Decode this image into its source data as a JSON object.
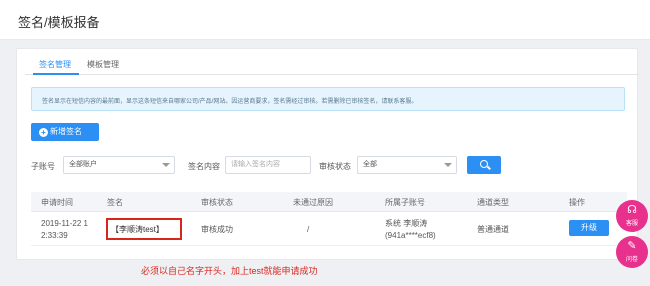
{
  "page": {
    "title": "签名/模板报备"
  },
  "tabs": [
    {
      "label": "签名管理",
      "active": true
    },
    {
      "label": "模板管理",
      "active": false
    }
  ],
  "notice": "签名显示在短信内容的最前面，显示这条短信来自哪家公司/产品/网站。因运营商要求，签名需经过审核。若需删除已审核签名，请联系客服。",
  "toolbar": {
    "add_label": "新增签名",
    "add_icon": "plus-icon"
  },
  "filters": {
    "account_label": "子账号",
    "account_value": "全部账户",
    "content_label": "签名内容",
    "content_placeholder": "请输入签名内容",
    "status_label": "审核状态",
    "status_value": "全部",
    "search_icon": "search-icon"
  },
  "table": {
    "headers": [
      "申请时间",
      "签名",
      "审核状态",
      "未通过原因",
      "所属子账号",
      "通道类型",
      "操作"
    ],
    "rows": [
      {
        "time_line1": "2019-11-22 1",
        "time_line2": "2:33:39",
        "signature": "【李顺涛test】",
        "status": "审核成功",
        "reason": "/",
        "account_line1": "系统 李顺涛",
        "account_line2": "(941a****ecf8)",
        "channel": "普通通道",
        "action": "升级"
      }
    ]
  },
  "annotation": "必须以自己名字开头，加上test就能申请成功",
  "float": [
    {
      "label": "客服",
      "icon": "headset-icon"
    },
    {
      "label": "问卷",
      "icon": "survey-icon"
    }
  ],
  "colors": {
    "accent": "#2c8ff3",
    "annotation": "#d9261c",
    "float": "#e8318c"
  }
}
